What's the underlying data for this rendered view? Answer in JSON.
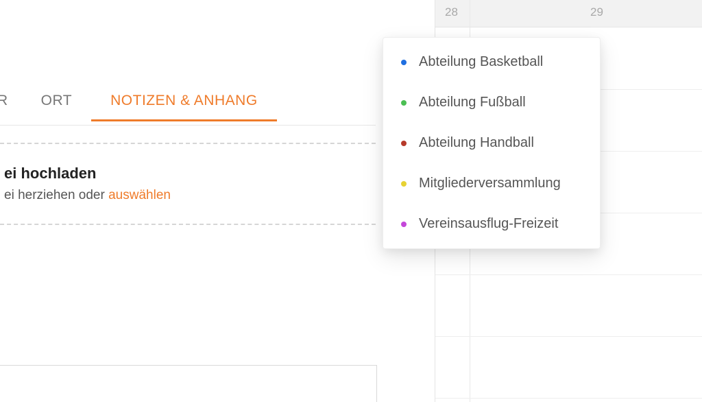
{
  "tabs": {
    "prev_cut": "R",
    "ort": "ORT",
    "notes": "NOTIZEN & ANHANG"
  },
  "dropzone": {
    "title_cut": "ei hochladen",
    "sub_cut": "ei herziehen oder ",
    "link": "auswählen"
  },
  "calendar": {
    "day28": "28",
    "day29": "29"
  },
  "categories": [
    {
      "label": "Abteilung Basketball",
      "color": "#1f6fe0"
    },
    {
      "label": "Abteilung Fußball",
      "color": "#4bbf53"
    },
    {
      "label": "Abteilung Handball",
      "color": "#b63a2a"
    },
    {
      "label": "Mitgliederversammlung",
      "color": "#e7d233"
    },
    {
      "label": "Vereinsausflug-Freizeit",
      "color": "#c447d9"
    }
  ],
  "colors": {
    "accent": "#ef7b2a"
  }
}
